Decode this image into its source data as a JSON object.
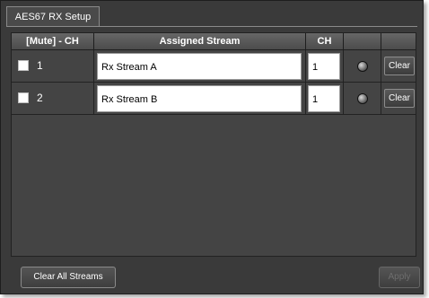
{
  "window": {
    "tab_title": "AES67 RX Setup"
  },
  "table": {
    "headers": {
      "mute_ch": "[Mute] - CH",
      "assigned_stream": "Assigned Stream",
      "ch": "CH",
      "status": "",
      "action": ""
    },
    "rows": [
      {
        "channel": "1",
        "muted": false,
        "stream": "Rx Stream A",
        "stream_ch": "1",
        "clear_label": "Clear"
      },
      {
        "channel": "2",
        "muted": false,
        "stream": "Rx Stream B",
        "stream_ch": "1",
        "clear_label": "Clear"
      }
    ]
  },
  "footer": {
    "clear_all_label": "Clear All Streams",
    "apply_label": "Apply"
  },
  "colors": {
    "panel_bg": "#3a3a3a",
    "grid_bg": "#444444",
    "header_bg": "#5a5a5a",
    "field_bg": "#ffffff"
  }
}
